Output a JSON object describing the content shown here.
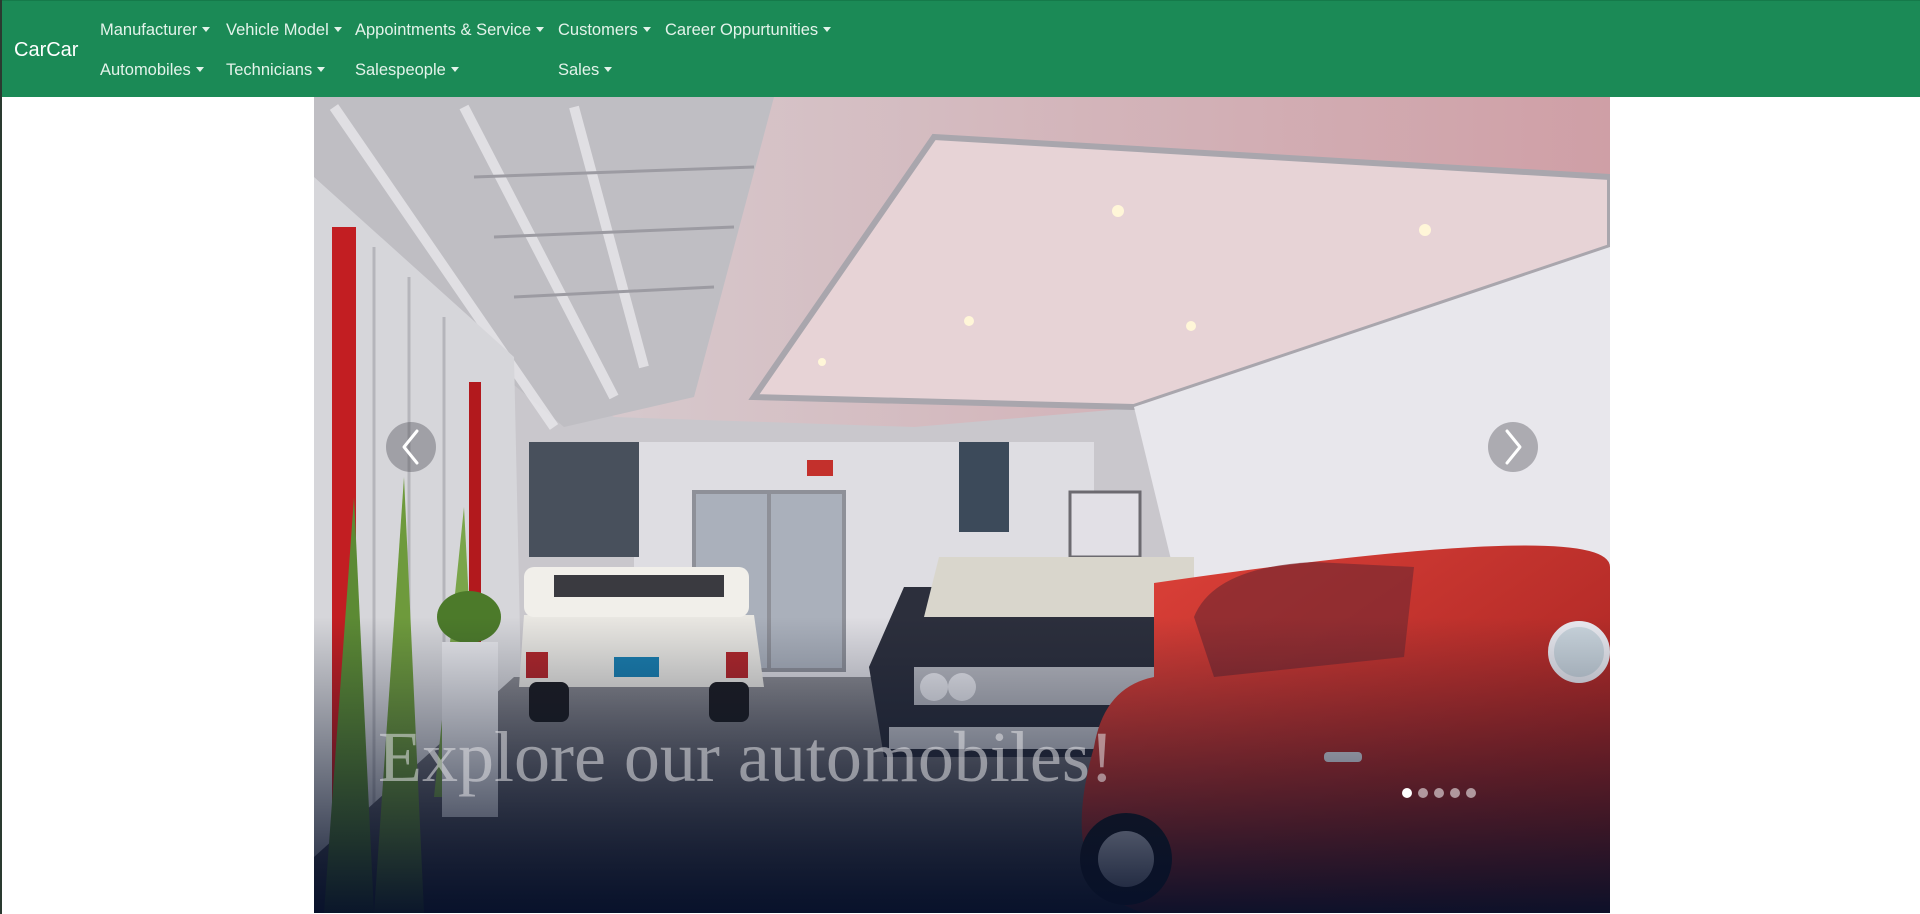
{
  "navbar": {
    "brand": "CarCar",
    "row1": [
      {
        "name": "nav-manufacturer",
        "label": "Manufacturer"
      },
      {
        "name": "nav-vehicle-model",
        "label": "Vehicle Model"
      },
      {
        "name": "nav-appointments-service",
        "label": "Appointments & Service"
      },
      {
        "name": "nav-customers",
        "label": "Customers"
      },
      {
        "name": "nav-career-oppurtunities",
        "label": "Career Oppurtunities"
      }
    ],
    "row2": [
      {
        "name": "nav-automobiles",
        "label": "Automobiles"
      },
      {
        "name": "nav-technicians",
        "label": "Technicians"
      },
      {
        "name": "nav-salespeople",
        "label": "Salespeople"
      },
      {
        "name": "nav-sales",
        "label": "Sales"
      }
    ],
    "background_color": "#1b8a56"
  },
  "carousel": {
    "caption": "Explore our automobiles!",
    "slide_count": 5,
    "active_slide": 1,
    "prev_icon": "chevron-left-icon",
    "next_icon": "chevron-right-icon"
  }
}
